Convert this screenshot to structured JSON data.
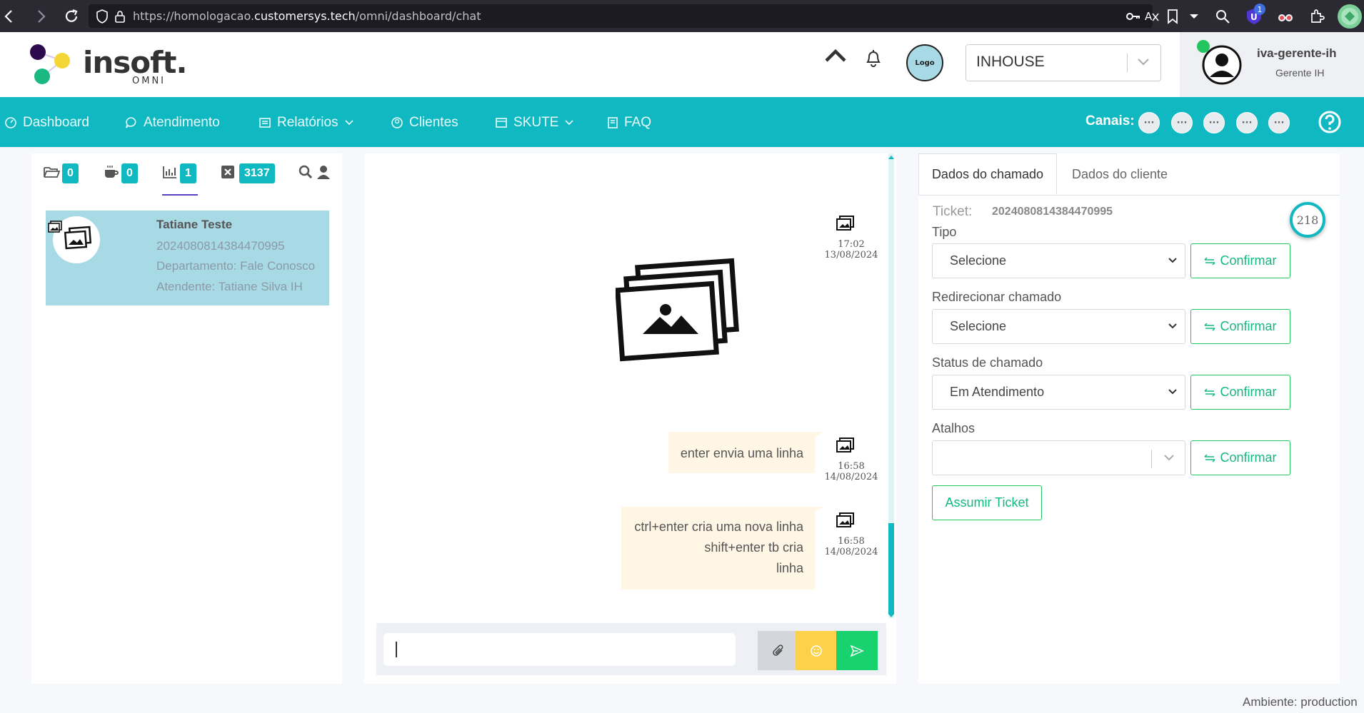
{
  "browser": {
    "url_prefix": "https://homologacao.",
    "url_domain": "customersys.tech",
    "url_path": "/omni/dashboard/chat",
    "ext_badge": "1"
  },
  "header": {
    "logo_text": "insoft.",
    "logo_sub": "OMNI",
    "company_logo": "Logo",
    "company_select": "INHOUSE",
    "user_name": "iva-gerente-ih",
    "user_role": "Gerente IH"
  },
  "nav": {
    "items": [
      {
        "label": "Dashboard",
        "icon": "dashboard-icon"
      },
      {
        "label": "Atendimento",
        "icon": "chat-icon"
      },
      {
        "label": "Relatórios",
        "icon": "report-icon"
      },
      {
        "label": "Clientes",
        "icon": "clients-icon"
      },
      {
        "label": "SKUTE",
        "icon": "skute-icon"
      },
      {
        "label": "FAQ",
        "icon": "faq-icon"
      }
    ],
    "canais_label": "Canais:",
    "canal_dots": [
      "···",
      "···",
      "···",
      "···",
      "···"
    ]
  },
  "queue_tabs": {
    "open_count": "0",
    "paused_count": "0",
    "active_count": "1",
    "closed_count": "3137"
  },
  "ticket_card": {
    "name": "Tatiane Teste",
    "ticket_id": "2024080814384470995",
    "department": "Departamento: Fale Conosco",
    "agent": "Atendente: Tatiane Silva IH"
  },
  "messages": [
    {
      "type": "image",
      "time": "17:02",
      "date": "13/08/2024"
    },
    {
      "type": "text",
      "text": "enter envia uma linha",
      "time": "16:58",
      "date": "14/08/2024"
    },
    {
      "type": "text",
      "lines": [
        "ctrl+enter cria uma nova linha",
        "shift+enter tb cria",
        "linha"
      ],
      "time": "16:58",
      "date": "14/08/2024"
    }
  ],
  "details": {
    "tab_ticket": "Dados do chamado",
    "tab_client": "Dados do cliente",
    "ticket_label": "Ticket:",
    "ticket_id": "2024080814384470995",
    "counter": "218",
    "tipo_label": "Tipo",
    "tipo_value": "Selecione",
    "redirect_label": "Redirecionar chamado",
    "redirect_value": "Selecione",
    "status_label": "Status de chamado",
    "status_value": "Em Atendimento",
    "atalhos_label": "Atalhos",
    "atalhos_value": "",
    "confirm_label": "Confirmar",
    "assume_label": "Assumir Ticket"
  },
  "footer": {
    "env": "Ambiente: production"
  },
  "colors": {
    "primary": "#10b8c2",
    "card": "#a8dae6",
    "bubble": "#fff6e5",
    "confirm": "#22c55e",
    "emoji_btn": "#fdd14a",
    "send_btn": "#18d26e"
  }
}
